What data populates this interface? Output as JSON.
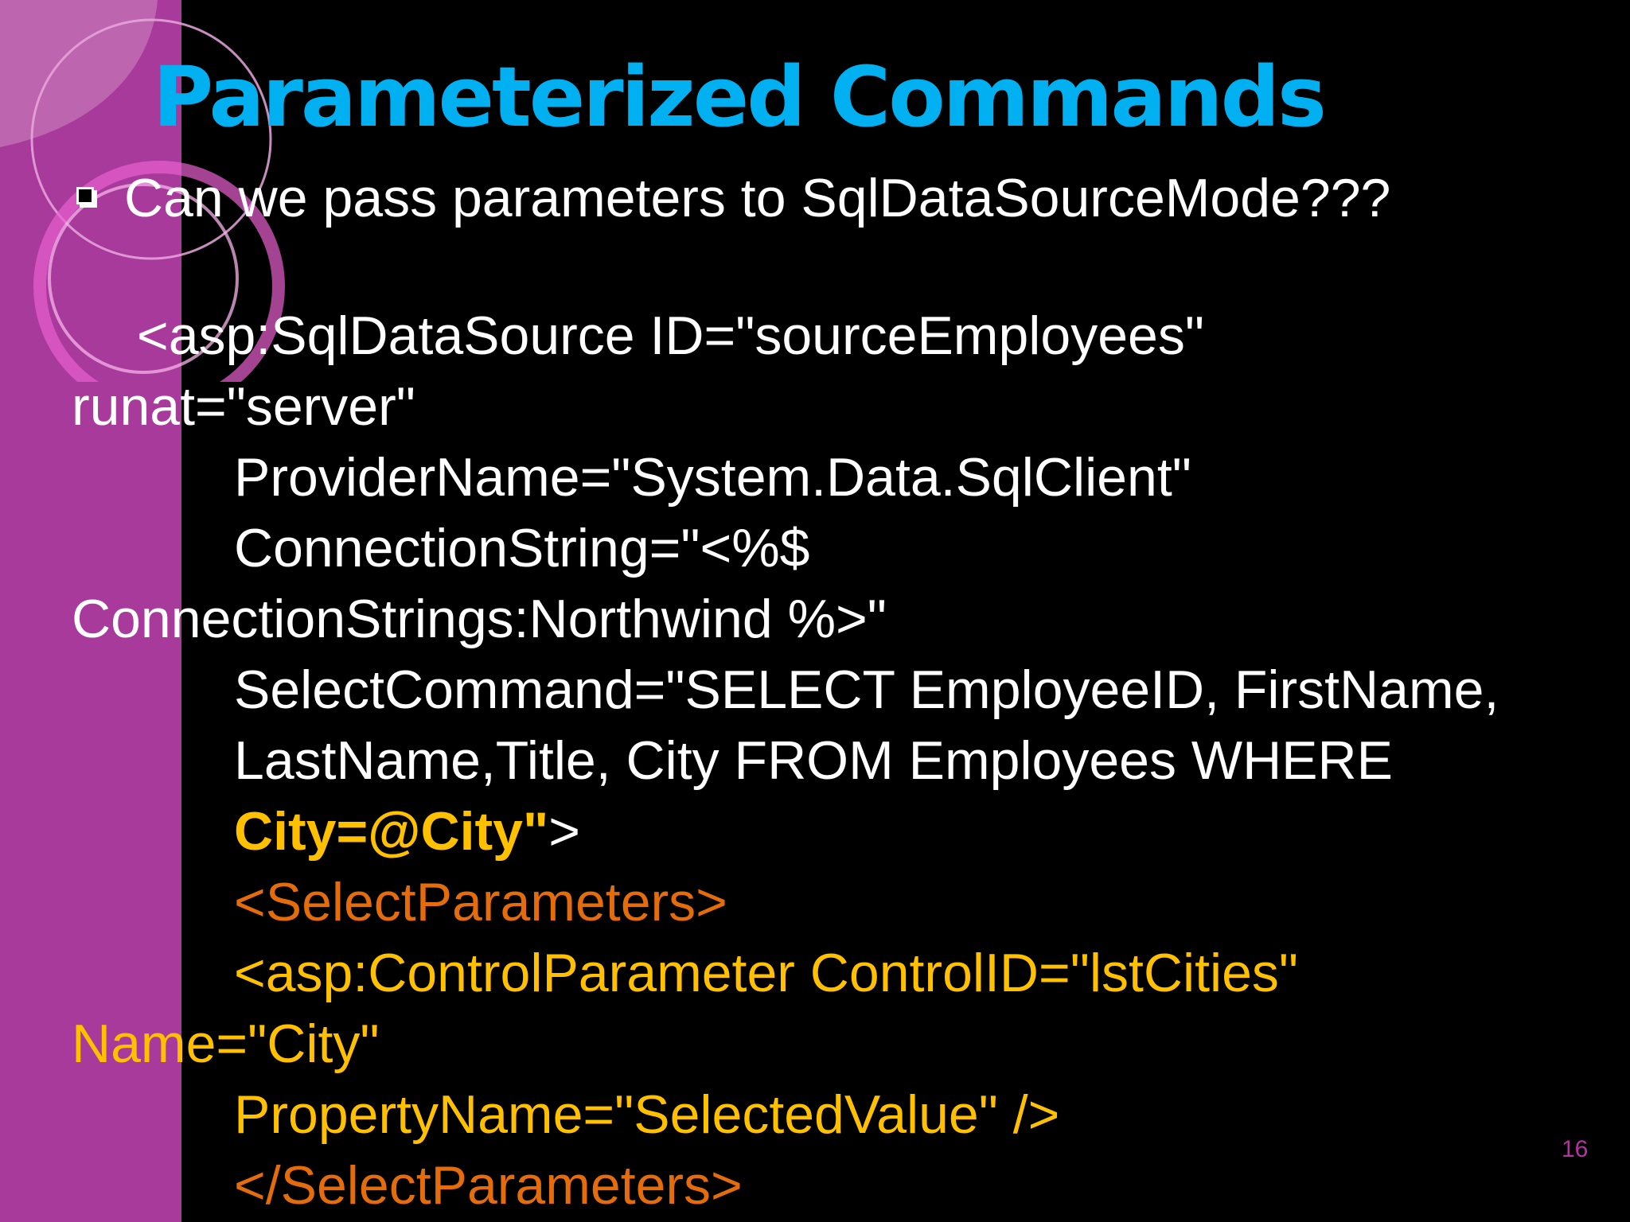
{
  "slide": {
    "title": "Parameterized Commands",
    "bullet": "Can we pass parameters to SqlDataSourceMode???",
    "code_lines": [
      "<asp:SqlDataSource ID=\"sourceEmployees\"",
      "runat=\"server\"",
      "ProviderName=\"System.Data.SqlClient\"",
      "ConnectionString=\"<%$",
      "ConnectionStrings:Northwind %>\"",
      "SelectCommand=\"SELECT EmployeeID, FirstName,",
      "LastName,Title, City FROM Employees WHERE",
      "City=@City\"",
      ">",
      "<SelectParameters>",
      "<asp:ControlParameter ControlID=\"lstCities\"",
      "Name=\"City\"",
      "PropertyName=\"SelectedValue\" />",
      "</SelectParameters>"
    ],
    "page_number": "16",
    "colors": {
      "background": "#000000",
      "sidebar": "#a73a9b",
      "title": "#00b0f0",
      "text": "#ffffff",
      "highlight": "#ffc000",
      "tag": "#e46c0a",
      "page_number": "#b2359f"
    }
  }
}
